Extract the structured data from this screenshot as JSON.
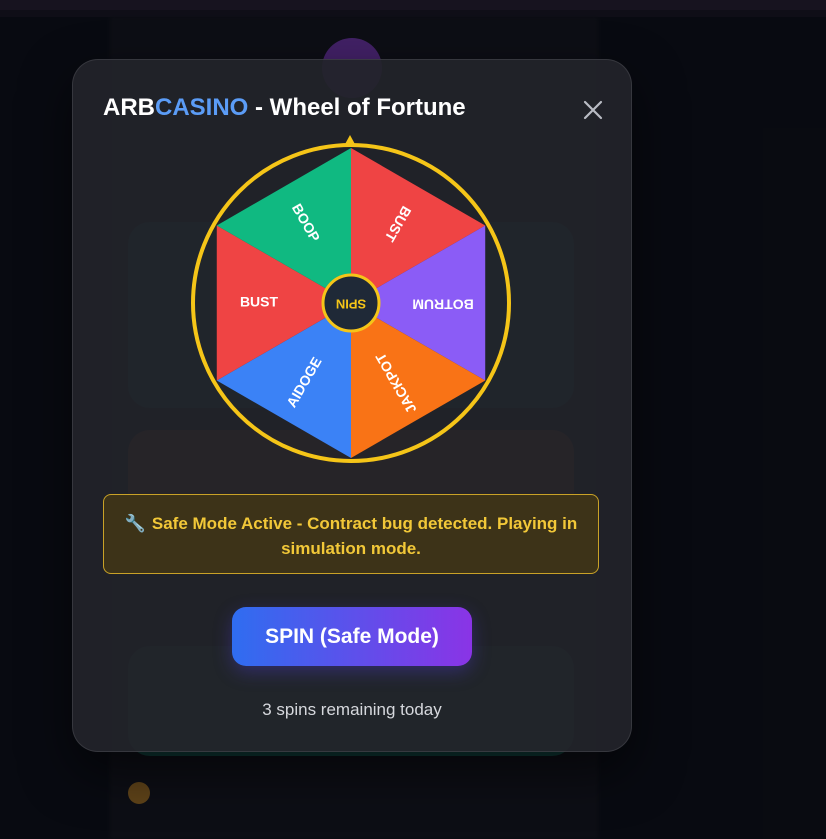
{
  "modal": {
    "title_brand_a": "ARB",
    "title_brand_b": "CASINO",
    "title_rest": " - Wheel of Fortune",
    "close_icon": "close-icon",
    "notice_icon": "wrench-icon",
    "notice_text": "Safe Mode Active - Contract bug detected. Playing in simulation mode.",
    "spin_button": "SPIN (Safe Mode)",
    "remaining": "3 spins remaining today"
  },
  "wheel": {
    "center_label": "SPIN",
    "segments": [
      {
        "label": "BUST",
        "color": "#ef4444"
      },
      {
        "label": "BOTRUM",
        "color": "#8b5cf6"
      },
      {
        "label": "JACKPOT",
        "color": "#f97316"
      },
      {
        "label": "AIDOGE",
        "color": "#3b82f6"
      },
      {
        "label": "BUST",
        "color": "#ef4444"
      },
      {
        "label": "BOOP",
        "color": "#10b981"
      }
    ],
    "rim_color": "#f5c518",
    "hub_color": "#1f2937"
  },
  "colors": {
    "accent": "#5b9cf6",
    "notice_text": "#f2c838",
    "spin_gradient_start": "#2f6df0",
    "spin_gradient_end": "#8a34e6"
  }
}
